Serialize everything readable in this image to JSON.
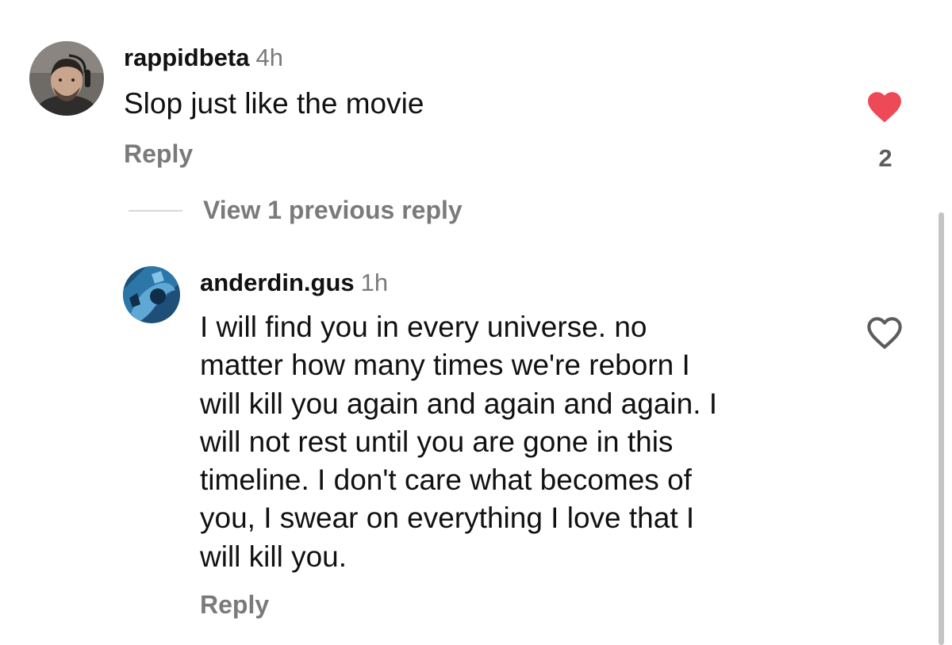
{
  "comment_1": {
    "username": "rappidbeta",
    "time": "4h",
    "text": "Slop just like the movie",
    "reply_label": "Reply",
    "liked": true,
    "like_count": "2",
    "heart_color": "#ed4956"
  },
  "replies_toggle": {
    "label": "View 1 previous reply"
  },
  "comment_2": {
    "username": "anderdin.gus",
    "time": "1h",
    "text_lines": [
      "I will find you in every universe. no",
      "matter how many times we're reborn I",
      "will kill you again and again and again. I",
      "will not rest until you are gone in this",
      "timeline. I don't care what becomes of",
      "you, I swear on everything I love that I",
      "will kill you."
    ],
    "reply_label": "Reply",
    "liked": false
  },
  "icons": {
    "like_filled": "heart-filled-icon",
    "like_outline": "heart-outline-icon"
  }
}
